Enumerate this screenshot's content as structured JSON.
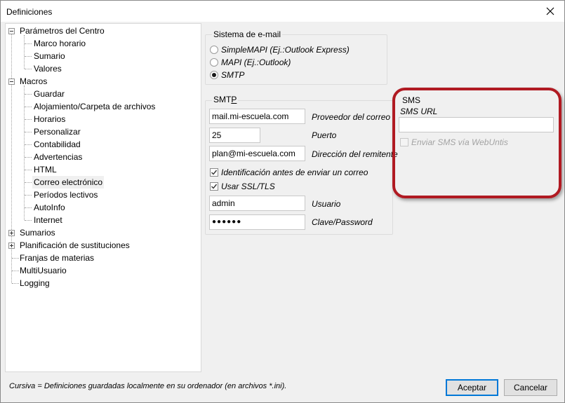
{
  "window": {
    "title": "Definiciones"
  },
  "tree": {
    "items": [
      {
        "label": "Parámetros del Centro",
        "expander": "minus"
      },
      {
        "label": "Marco horario"
      },
      {
        "label": "Sumario"
      },
      {
        "label": "Valores"
      },
      {
        "label": "Macros",
        "expander": "minus"
      },
      {
        "label": "Guardar"
      },
      {
        "label": "Alojamiento/Carpeta de archivos"
      },
      {
        "label": "Horarios"
      },
      {
        "label": "Personalizar"
      },
      {
        "label": "Contabilidad"
      },
      {
        "label": "Advertencias"
      },
      {
        "label": "HTML"
      },
      {
        "label": "Correo electrónico",
        "selected": true
      },
      {
        "label": "Períodos lectivos"
      },
      {
        "label": "AutoInfo"
      },
      {
        "label": "Internet"
      },
      {
        "label": "Sumarios",
        "expander": "plus"
      },
      {
        "label": "Planificación de sustituciones",
        "expander": "plus"
      },
      {
        "label": "Franjas de materias"
      },
      {
        "label": "MultiUsuario"
      },
      {
        "label": "Logging"
      }
    ]
  },
  "email_system": {
    "legend": "Sistema de e-mail",
    "options": [
      {
        "label": "SimpleMAPI (Ej.:Outlook Express)",
        "selected": false
      },
      {
        "label": "MAPI (Ej.:Outlook)",
        "selected": false
      },
      {
        "label": "SMTP",
        "selected": true
      }
    ]
  },
  "smtp": {
    "legend_prefix": "SMT",
    "legend_underlined": "P",
    "provider": {
      "value": "mail.mi-escuela.com",
      "label": "Proveedor del correo"
    },
    "port": {
      "value": "25",
      "label": "Puerto"
    },
    "sender": {
      "value": "plan@mi-escuela.com",
      "label": "Dirección del remitente"
    },
    "auth_check": {
      "label": "Identificación antes de enviar un correo",
      "checked": true
    },
    "ssl_check": {
      "label": "Usar SSL/TLS",
      "checked": true
    },
    "user": {
      "value": "admin",
      "label": "Usuario"
    },
    "password": {
      "value": "●●●●●●",
      "label": "Clave/Password"
    }
  },
  "sms": {
    "legend": "SMS",
    "url_label": "SMS URL",
    "url_value": "",
    "send_check": {
      "label": "Enviar SMS vía WebUntis",
      "checked": false,
      "enabled": false
    }
  },
  "footer": {
    "note": "Cursiva = Definiciones guardadas localmente en su ordenador (en archivos *.ini).",
    "accept": "Aceptar",
    "cancel": "Cancelar"
  },
  "colors": {
    "highlight": "#b01a22",
    "default_button_border": "#0078d7"
  }
}
